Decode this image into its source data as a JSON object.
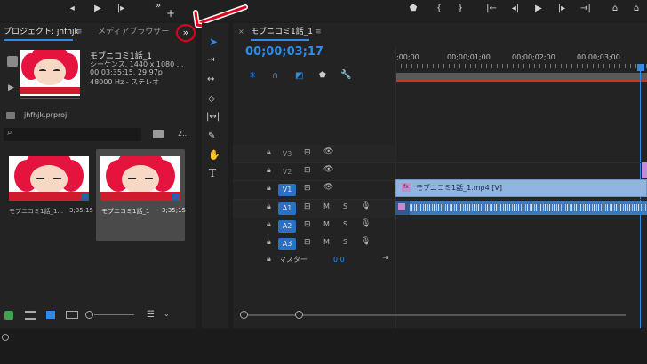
{
  "topbar": {
    "icons": [
      "rewind-step-icon",
      "play-icon",
      "step-forward-icon",
      "more-icon",
      "add-icon",
      "marker-icon",
      "in-point-icon",
      "out-point-icon",
      "go-to-in-icon",
      "step-back-icon",
      "play-icon",
      "step-forward-icon",
      "go-to-out-icon",
      "lift-icon",
      "extract-icon"
    ],
    "more_label": "»",
    "add_label": "+"
  },
  "project": {
    "tab_project": "プロジェクト: jhfhjk",
    "tab_media_browser": "メディアブラウザー",
    "menu_label": "≡",
    "overflow_label": "»",
    "clip_name": "モブニコミ1話_1",
    "clip_info_1": "シーケンス, 1440 x 1080 ...",
    "clip_info_2": "00;03;35;15, 29.97p",
    "clip_info_3": "48000 Hz - ステレオ",
    "project_file": "jhfhjk.prproj",
    "item_count": "2...",
    "items": [
      {
        "name": "モブニコミ1話_1...",
        "duration": "3;35;15"
      },
      {
        "name": "モブニコミ1話_1",
        "duration": "3;35;15"
      }
    ]
  },
  "timeline": {
    "tab_label": "モブニコミ1話_1",
    "close_label": "×",
    "menu_label": "≡",
    "timecode": "00;00;03;17",
    "ruler": [
      ";00;00",
      "00;00;01;00",
      "00;00;02;00",
      "00;00;03;00"
    ],
    "tracks": [
      {
        "id": "V3",
        "label": "V3"
      },
      {
        "id": "V2",
        "label": "V2"
      },
      {
        "id": "V1",
        "label": "V1"
      },
      {
        "id": "A1",
        "label": "A1"
      },
      {
        "id": "A2",
        "label": "A2"
      },
      {
        "id": "A3",
        "label": "A3"
      }
    ],
    "master_label": "マスター",
    "master_value": "0.0",
    "mute_label": "M",
    "solo_label": "S",
    "video_clip_label": "モブニコミ1話_1.mp4 [V]",
    "fx_label": "fx"
  },
  "colors": {
    "accent_blue": "#2d8ceb",
    "clip_video": "#8fb5e0",
    "clip_audio": "#3f78b8",
    "annotation_red": "#e0001b"
  }
}
